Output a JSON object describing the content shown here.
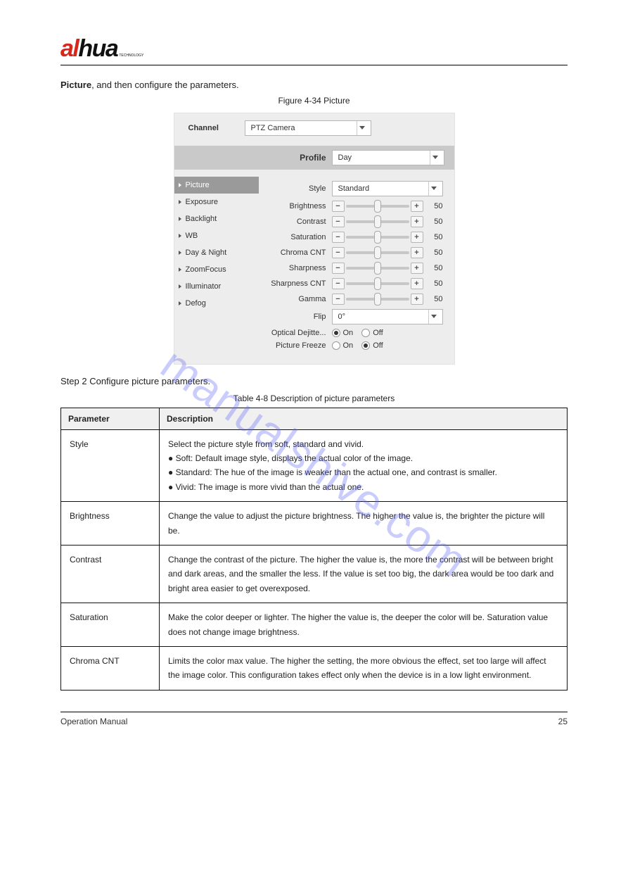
{
  "header": {
    "logo_text": "alhua",
    "logo_tag": "TECHNOLOGY"
  },
  "intro_bold": "Picture",
  "intro_rest": ", and then configure the parameters.",
  "figure_caption": "Figure 4-34 Picture",
  "shot": {
    "channel_label": "Channel",
    "channel_value": "PTZ Camera",
    "profile_label": "Profile",
    "profile_value": "Day",
    "nav": [
      {
        "label": "Picture",
        "active": true
      },
      {
        "label": "Exposure"
      },
      {
        "label": "Backlight"
      },
      {
        "label": "WB"
      },
      {
        "label": "Day & Night"
      },
      {
        "label": "ZoomFocus"
      },
      {
        "label": "Illuminator"
      },
      {
        "label": "Defog"
      }
    ],
    "style_label": "Style",
    "style_value": "Standard",
    "sliders": [
      {
        "label": "Brightness",
        "value": "50"
      },
      {
        "label": "Contrast",
        "value": "50"
      },
      {
        "label": "Saturation",
        "value": "50"
      },
      {
        "label": "Chroma CNT",
        "value": "50"
      },
      {
        "label": "Sharpness",
        "value": "50"
      },
      {
        "label": "Sharpness CNT",
        "value": "50"
      },
      {
        "label": "Gamma",
        "value": "50"
      }
    ],
    "flip_label": "Flip",
    "flip_value": "0°",
    "radios": [
      {
        "label": "Optical Dejitte...",
        "on_label": "On",
        "off_label": "Off",
        "selected": "on"
      },
      {
        "label": "Picture Freeze",
        "on_label": "On",
        "off_label": "Off",
        "selected": "off"
      }
    ]
  },
  "watermark": "manualshive.com",
  "step2_line": "Step 2   Configure picture parameters.",
  "table_caption": "Table 4-8 Description of picture parameters",
  "table": {
    "head_param": "Parameter",
    "head_desc": "Description",
    "rows": [
      {
        "param": "Style",
        "desc": "Select the picture style from soft, standard and vivid.\n● Soft: Default image style, displays the actual color of the image.\n● Standard: The hue of the image is weaker than the actual one, and contrast is smaller.\n● Vivid: The image is more vivid than the actual one."
      },
      {
        "param": "Brightness",
        "desc": "Change the value to adjust the picture brightness. The higher the value is, the brighter the picture will be."
      },
      {
        "param": "Contrast",
        "desc": "Change the contrast of the picture. The higher the value is, the more the contrast will be between bright and dark areas, and the smaller the less. If the value is set too big, the dark area would be too dark and bright area easier to get overexposed."
      },
      {
        "param": "Saturation",
        "desc": "Make the color deeper or lighter. The higher the value is, the deeper the color will be. Saturation value does not change image brightness."
      },
      {
        "param": "Chroma CNT",
        "desc": "Limits the color max value. The higher the setting, the more obvious the effect, set too large will affect the image color. This configuration takes effect only when the device is in a low light environment."
      }
    ]
  },
  "footer": {
    "left": "Operation Manual",
    "right": "25"
  }
}
